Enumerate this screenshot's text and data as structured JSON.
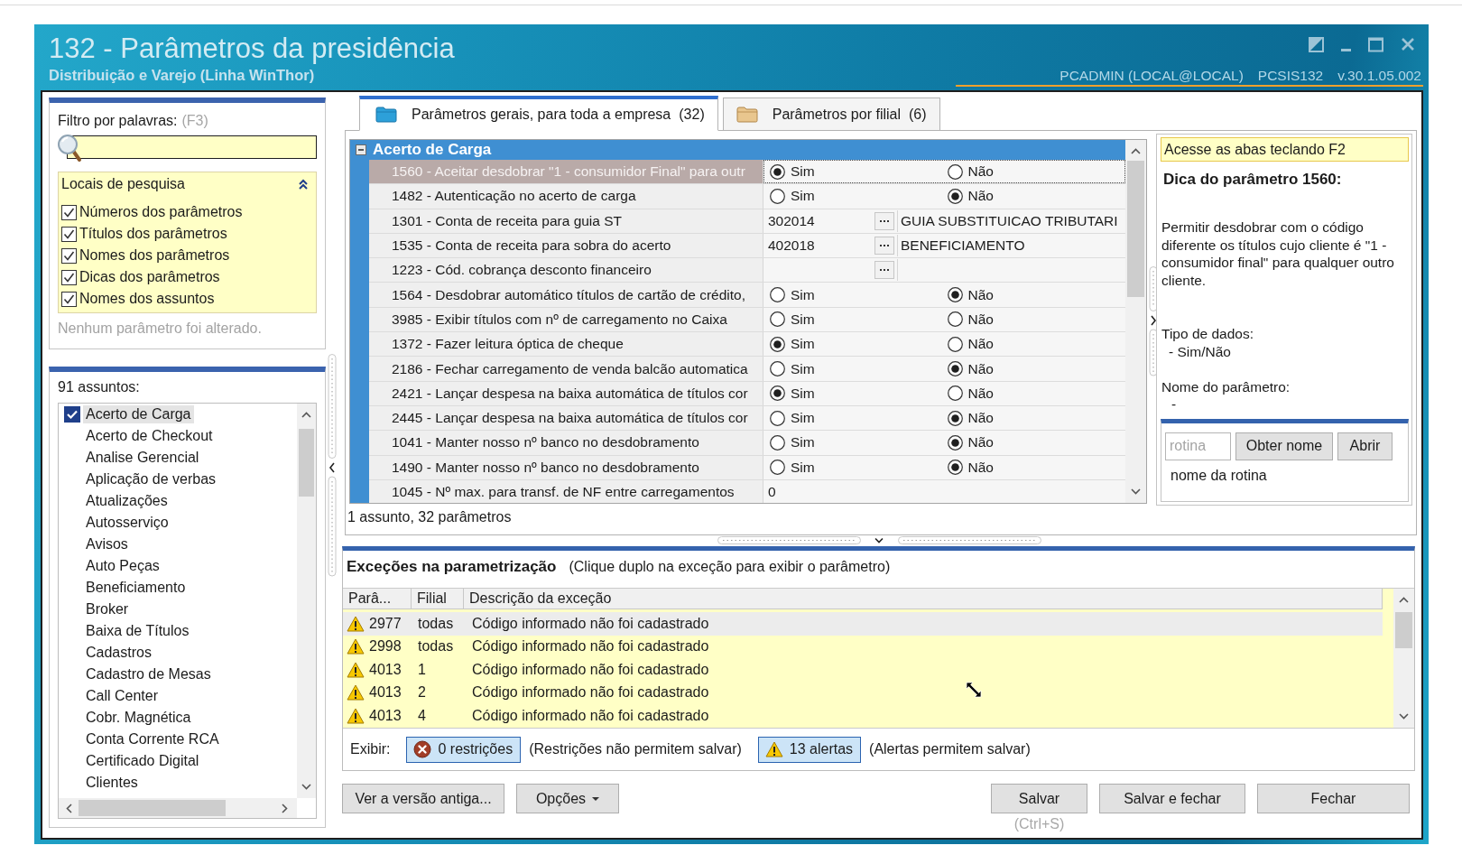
{
  "window": {
    "title": "132 - Parâmetros da presidência",
    "subtitle": "Distribuição e Varejo (Linha WinThor)",
    "user": "PCADMIN (LOCAL@LOCAL)",
    "module": "PCSIS132",
    "version": "v.30.1.05.002"
  },
  "filter": {
    "label": "Filtro por palavras:",
    "shortcut": "(F3)",
    "search_locations": {
      "title": "Locais de pesquisa",
      "expanded": true,
      "options": [
        {
          "label": "Números dos parâmetros",
          "checked": true
        },
        {
          "label": "Títulos dos parâmetros",
          "checked": true
        },
        {
          "label": "Nomes dos parâmetros",
          "checked": true
        },
        {
          "label": "Dicas dos parâmetros",
          "checked": true
        },
        {
          "label": "Nomes dos assuntos",
          "checked": true
        }
      ]
    },
    "status": "Nenhum parâmetro foi alterado."
  },
  "subjects": {
    "count_label": "91 assuntos:",
    "items": [
      {
        "label": "Acerto de Carga",
        "checked": true,
        "selected": true
      },
      {
        "label": "Acerto de Checkout",
        "checked": false,
        "selected": false
      },
      {
        "label": "Analise Gerencial",
        "checked": false,
        "selected": false
      },
      {
        "label": "Aplicação de verbas",
        "checked": false,
        "selected": false
      },
      {
        "label": "Atualizações",
        "checked": false,
        "selected": false
      },
      {
        "label": "Autosserviço",
        "checked": false,
        "selected": false
      },
      {
        "label": "Avisos",
        "checked": false,
        "selected": false
      },
      {
        "label": "Auto Peças",
        "checked": false,
        "selected": false
      },
      {
        "label": "Beneficiamento",
        "checked": false,
        "selected": false
      },
      {
        "label": "Broker",
        "checked": false,
        "selected": false
      },
      {
        "label": "Baixa de Títulos",
        "checked": false,
        "selected": false
      },
      {
        "label": "Cadastros",
        "checked": false,
        "selected": false
      },
      {
        "label": "Cadastro de Mesas",
        "checked": false,
        "selected": false
      },
      {
        "label": "Call Center",
        "checked": false,
        "selected": false
      },
      {
        "label": "Cobr. Magnética",
        "checked": false,
        "selected": false
      },
      {
        "label": "Conta Corrente RCA",
        "checked": false,
        "selected": false
      },
      {
        "label": "Certificado Digital",
        "checked": false,
        "selected": false
      },
      {
        "label": "Clientes",
        "checked": false,
        "selected": false
      }
    ]
  },
  "tabs": [
    {
      "label": "Parâmetros gerais, para toda a empresa",
      "count": "(32)",
      "selected": true
    },
    {
      "label": "Parâmetros por filial",
      "count": "(6)",
      "selected": false
    }
  ],
  "grid": {
    "group": {
      "title": "Acerto de Carga",
      "expanded": true
    },
    "rows": [
      {
        "kind": "choice",
        "label": "1560 - Aceitar desdobrar \"1 - consumidor Final\" para outr",
        "selected": true,
        "options": [
          {
            "label": "Sim",
            "selected": true
          },
          {
            "label": "Não",
            "selected": false
          }
        ]
      },
      {
        "kind": "choice",
        "label": "1482 - Autenticação no acerto de carga",
        "selected": false,
        "options": [
          {
            "label": "Sim",
            "selected": false
          },
          {
            "label": "Não",
            "selected": true
          }
        ]
      },
      {
        "kind": "lookup",
        "label": "1301 - Conta de receita para guia ST",
        "selected": false,
        "value": "302014",
        "description": "GUIA SUBSTITUICAO TRIBUTARI"
      },
      {
        "kind": "lookup",
        "label": "1535 - Conta de receita para sobra do acerto",
        "selected": false,
        "value": "402018",
        "description": "BENEFICIAMENTO"
      },
      {
        "kind": "lookup",
        "label": "1223 - Cód. cobrança desconto financeiro",
        "selected": false
      },
      {
        "kind": "choice",
        "label": "1564 - Desdobrar automático títulos de cartão de crédito,",
        "selected": false,
        "options": [
          {
            "label": "Sim",
            "selected": false
          },
          {
            "label": "Não",
            "selected": true
          }
        ]
      },
      {
        "kind": "choice",
        "label": "3985 - Exibir títulos com nº de carregamento no Caixa",
        "selected": false,
        "options": [
          {
            "label": "Sim",
            "selected": false
          },
          {
            "label": "Não",
            "selected": false
          }
        ]
      },
      {
        "kind": "choice",
        "label": "1372 - Fazer leitura óptica de cheque",
        "selected": false,
        "options": [
          {
            "label": "Sim",
            "selected": true
          },
          {
            "label": "Não",
            "selected": false
          }
        ]
      },
      {
        "kind": "choice",
        "label": "2186 - Fechar carregamento de venda balcão automatica",
        "selected": false,
        "options": [
          {
            "label": "Sim",
            "selected": false
          },
          {
            "label": "Não",
            "selected": true
          }
        ]
      },
      {
        "kind": "choice",
        "label": "2421 - Lançar despesa na baixa automática de títulos cor",
        "selected": false,
        "options": [
          {
            "label": "Sim",
            "selected": true
          },
          {
            "label": "Não",
            "selected": false
          }
        ]
      },
      {
        "kind": "choice",
        "label": "2445 - Lançar despesa na baixa automática de títulos cor",
        "selected": false,
        "options": [
          {
            "label": "Sim",
            "selected": false
          },
          {
            "label": "Não",
            "selected": true
          }
        ]
      },
      {
        "kind": "choice",
        "label": "1041 - Manter nosso nº banco no desdobramento",
        "selected": false,
        "options": [
          {
            "label": "Sim",
            "selected": false
          },
          {
            "label": "Não",
            "selected": true
          }
        ]
      },
      {
        "kind": "choice",
        "label": "1490 - Manter nosso nº banco no desdobramento",
        "selected": false,
        "options": [
          {
            "label": "Sim",
            "selected": false
          },
          {
            "label": "Não",
            "selected": true
          }
        ]
      },
      {
        "kind": "number",
        "label": "1045 - Nº max. para transf. de NF entre carregamentos",
        "selected": false,
        "value": "0"
      }
    ]
  },
  "grid_status": "1 assunto, 32 parâmetros",
  "hint_panel": {
    "banner": "Acesse as abas teclando F2",
    "title": "Dica do parâmetro 1560:",
    "description": "Permitir desdobrar com o código diferente os títulos cujo cliente é \"1 - consumidor final\" para qualquer outro cliente.",
    "data_type_label": "Tipo de dados:",
    "data_type": "- Sim/Não",
    "name_label": "Nome do parâmetro:",
    "name": "-",
    "routine": {
      "placeholder": "rotina",
      "buttons": [
        "Obter nome",
        "Abrir"
      ],
      "caption": "nome da rotina"
    }
  },
  "exceptions": {
    "title": "Exceções na parametrização",
    "hint": "(Clique duplo na exceção para exibir o parâmetro)",
    "columns": [
      "Parâ...",
      "Filial",
      "Descrição da exceção"
    ],
    "rows": [
      {
        "param": "2977",
        "branch": "todas",
        "description": "Código informado não foi cadastrado",
        "selected": true
      },
      {
        "param": "2998",
        "branch": "todas",
        "description": "Código informado não foi cadastrado",
        "selected": false
      },
      {
        "param": "4013",
        "branch": "1",
        "description": "Código informado não foi cadastrado",
        "selected": false
      },
      {
        "param": "4013",
        "branch": "2",
        "description": "Código informado não foi cadastrado",
        "selected": false
      },
      {
        "param": "4013",
        "branch": "4",
        "description": "Código informado não foi cadastrado",
        "selected": false
      }
    ],
    "filters_label": "Exibir:",
    "filters": [
      {
        "kind": "restriction",
        "label": "0 restrições",
        "note": "(Restrições não permitem salvar)",
        "pressed": true
      },
      {
        "kind": "alert",
        "label": "13 alertas",
        "note": "(Alertas permitem salvar)",
        "pressed": true
      }
    ]
  },
  "actions": {
    "secondary": [
      {
        "kind": "plain",
        "label": "Ver a versão antiga..."
      },
      {
        "kind": "menu",
        "label": "Opções"
      }
    ],
    "primary": [
      {
        "kind": "plain",
        "label": "Salvar",
        "shortcut": "(Ctrl+S)"
      },
      {
        "kind": "plain",
        "label": "Salvar e fechar"
      },
      {
        "kind": "plain",
        "label": "Fechar"
      }
    ]
  }
}
